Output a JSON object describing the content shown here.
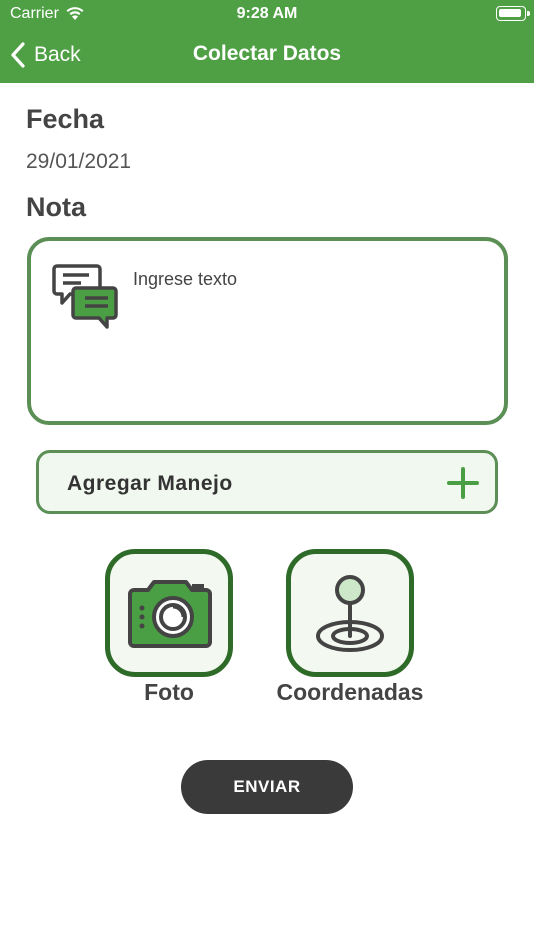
{
  "status_bar": {
    "carrier": "Carrier",
    "time": "9:28 AM"
  },
  "nav": {
    "back_label": "Back",
    "title": "Colectar Datos"
  },
  "form": {
    "fecha_label": "Fecha",
    "fecha_value": "29/01/2021",
    "nota_label": "Nota",
    "nota_placeholder": "Ingrese texto",
    "nota_value": ""
  },
  "manejo": {
    "label": "Agregar Manejo"
  },
  "actions": {
    "foto_label": "Foto",
    "coordenadas_label": "Coordenadas"
  },
  "submit": {
    "label": "ENVIAR"
  },
  "colors": {
    "header_green": "#4fa045",
    "border_green": "#5b8f55",
    "tile_border": "#2e6a28",
    "submit_bg": "#3a3a3a"
  },
  "icons": {
    "back": "chevron-left-icon",
    "wifi": "wifi-icon",
    "battery": "battery-icon",
    "note": "chat-bubbles-icon",
    "add": "plus-icon",
    "camera": "camera-icon",
    "location": "location-pin-icon"
  }
}
